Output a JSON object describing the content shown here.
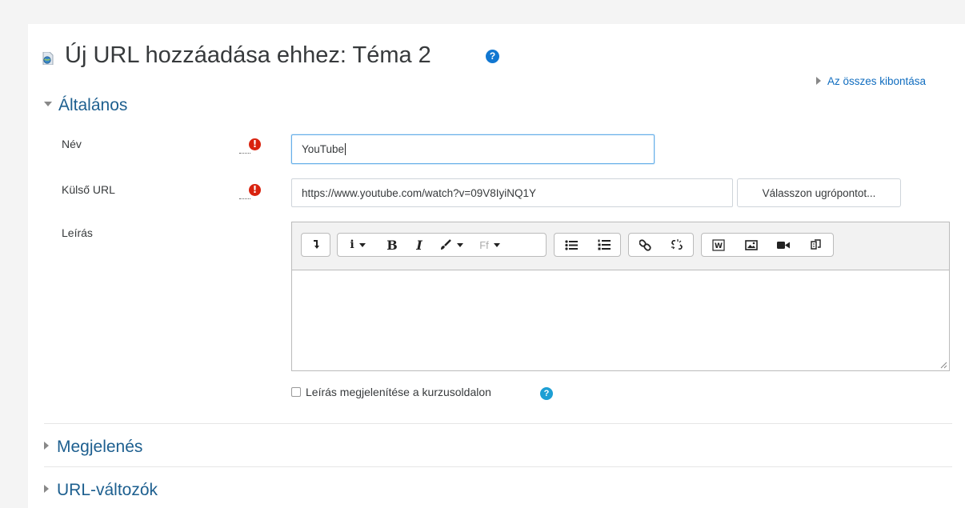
{
  "header": {
    "title": "Új URL hozzáadása ehhez: Téma 2",
    "help_glyph": "?",
    "expand_all": "Az összes kibontása"
  },
  "sections": {
    "general": {
      "title": "Általános",
      "expanded": true
    },
    "appearance": {
      "title": "Megjelenés",
      "expanded": false
    },
    "url_variables": {
      "title": "URL-változók",
      "expanded": false
    }
  },
  "form": {
    "name": {
      "label": "Név",
      "value": "YouTube",
      "required": true
    },
    "external_url": {
      "label": "Külső URL",
      "value": "https://www.youtube.com/watch?v=09V8IyiNQ1Y",
      "required": true,
      "choose_button": "Válasszon ugrópontot..."
    },
    "description": {
      "label": "Leírás",
      "value": "",
      "toolbar": {
        "paragraph_glyph": "i",
        "bold_glyph": "B",
        "italic_glyph": "I",
        "font_glyph": "Ff"
      }
    },
    "show_description": {
      "label": "Leírás megjelenítése a kurzusoldalon",
      "checked": false
    },
    "required_glyph": "!"
  },
  "colors": {
    "link": "#0f6cbf",
    "section": "#1d5f8f",
    "required": "#d9230f",
    "help": "#1177d1"
  },
  "icons": [
    "url-resource-icon",
    "help-icon",
    "required-icon",
    "collapse-icon",
    "expand-icon",
    "toolbar-toggle-icon",
    "paragraph-style-icon",
    "bold-icon",
    "italic-icon",
    "text-color-icon",
    "font-icon",
    "bullet-list-icon",
    "numbered-list-icon",
    "link-icon",
    "unlink-icon",
    "word-import-icon",
    "image-icon",
    "video-icon",
    "manage-files-icon"
  ]
}
